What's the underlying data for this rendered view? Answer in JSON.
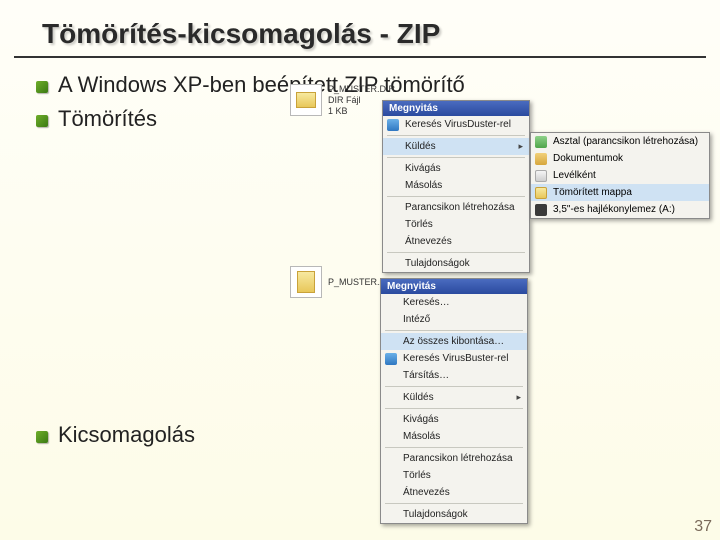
{
  "title": "Tömörítés-kicsomagolás - ZIP",
  "bullets": {
    "b1": "A Windows XP-ben beépített ZIP tömörítő",
    "b2": "Tömörítés",
    "b3": "Kicsomagolás"
  },
  "file1": {
    "name": "P_MUSTER.DIR",
    "type": "DIR Fájl",
    "size": "1 KB"
  },
  "file2": {
    "name": "P_MUSTER.zip"
  },
  "menu1": {
    "header": "Megnyitás",
    "items": [
      "Keresés VirusDuster-rel",
      "Küldés",
      "Kivágás",
      "Másolás",
      "Parancsikon létrehozása",
      "Törlés",
      "Átnevezés",
      "Tulajdonságok"
    ]
  },
  "submenu1": {
    "items": [
      "Asztal (parancsikon létrehozása)",
      "Dokumentumok",
      "Levélként",
      "Tömörített mappa",
      "3,5\"-es hajlékonylemez (A:)"
    ]
  },
  "menu2": {
    "header": "Megnyitás",
    "items": [
      "Keresés…",
      "Intéző",
      "Az összes kibontása…",
      "Keresés VirusBuster-rel",
      "Társítás…",
      "Küldés",
      "Kivágás",
      "Másolás",
      "Parancsikon létrehozása",
      "Törlés",
      "Átnevezés",
      "Tulajdonságok"
    ]
  },
  "slide_number": "37"
}
